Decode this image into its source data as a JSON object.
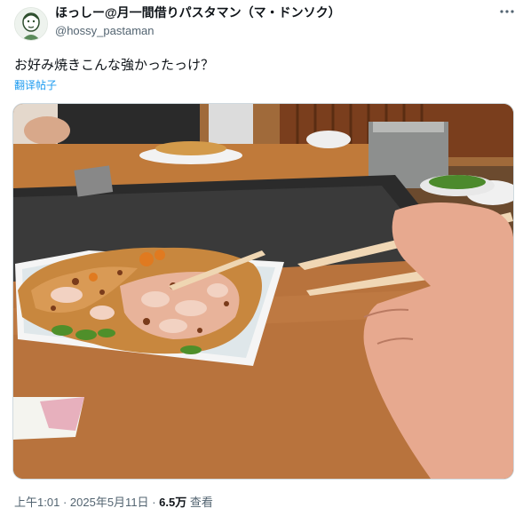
{
  "author": {
    "display_name": "ほっしー@月一間借りパスタマン（マ・ドンソク）",
    "handle": "@hossy_pastaman",
    "avatar_icon": "avatar-illustration-icon"
  },
  "more_icon": "more-options-icon",
  "tweet": {
    "text": "お好み焼きこんな強かったっけ？",
    "translate_label": "翻译帖子"
  },
  "media": {
    "icon": "photo-okonomiyaki-chopsticks"
  },
  "meta": {
    "time": "上午1:01",
    "separator": "·",
    "date": "2025年5月11日",
    "separator2": "·",
    "views_count": "6.5万",
    "views_label": "查看"
  },
  "colors": {
    "link": "#1d9bf0",
    "secondary_text": "#536471",
    "border": "#cfd9de"
  }
}
